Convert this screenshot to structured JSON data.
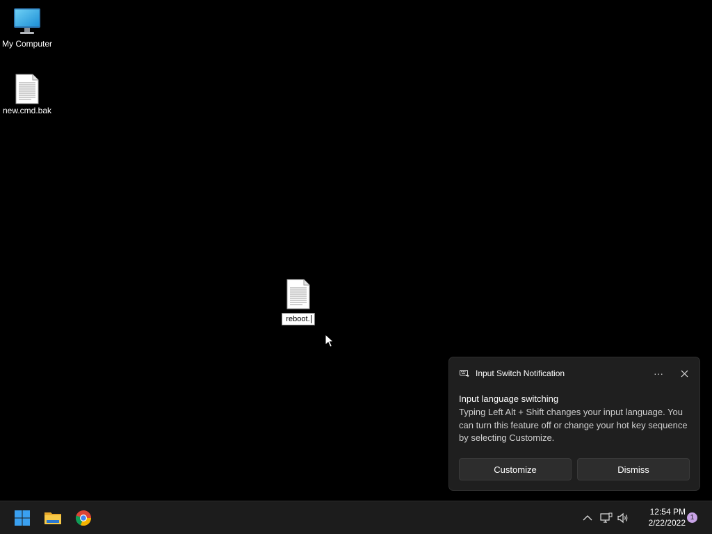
{
  "desktop": {
    "icons": [
      {
        "label": "My Computer",
        "icon": "monitor-icon"
      },
      {
        "label": "new.cmd.bak",
        "icon": "text-file-icon"
      }
    ],
    "renaming": {
      "value": "reboot.",
      "icon": "text-file-icon"
    }
  },
  "notification": {
    "app_name": "Input Switch Notification",
    "app_icon": "keyboard-switch-icon",
    "more_label": "···",
    "title": "Input language switching",
    "body": "Typing Left Alt + Shift changes your input language. You can turn this feature off or change your hot key sequence by selecting Customize.",
    "buttons": {
      "customize": "Customize",
      "dismiss": "Dismiss"
    }
  },
  "taskbar": {
    "pinned": [
      "windows-start-icon",
      "file-explorer-icon",
      "chrome-icon"
    ],
    "tray": [
      "chevron-up-icon",
      "network-icon",
      "volume-icon"
    ],
    "time": "12:54 PM",
    "date": "2/22/2022",
    "notification_count": "1"
  },
  "colors": {
    "desktop_bg": "#000000",
    "taskbar_bg": "#1c1c1c",
    "toast_bg": "#1f1f1f",
    "badge": "#c8a3e6",
    "start_blue": "#3aa0f0"
  }
}
